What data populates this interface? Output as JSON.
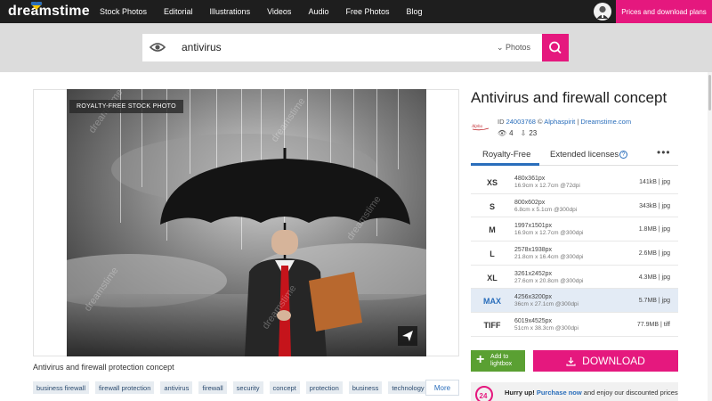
{
  "header": {
    "logo": "dreamstime",
    "nav": [
      "Stock Photos",
      "Editorial",
      "Illustrations",
      "Videos",
      "Audio",
      "Free Photos",
      "Blog"
    ],
    "plans_button": "Prices and download plans",
    "brand_color": "#e5187e"
  },
  "search": {
    "query": "antivirus",
    "category": "Photos"
  },
  "image": {
    "badge": "ROYALTY-FREE STOCK PHOTO",
    "caption": "Antivirus and firewall protection concept",
    "watermark": "dreamstime"
  },
  "tags": [
    "business firewall",
    "firewall protection",
    "antivirus",
    "firewall",
    "security",
    "concept",
    "protection",
    "business",
    "technology"
  ],
  "tags_more": "More",
  "detail": {
    "title": "Antivirus and firewall concept",
    "id_prefix": "ID ",
    "id": "24003768",
    "copyright": " © ",
    "author": "Alphaspirit",
    "separator": " | ",
    "site": "Dreamstime.com",
    "views": "4",
    "downloads": "23"
  },
  "license_tabs": {
    "royalty_free": "Royalty-Free",
    "extended": "Extended licenses",
    "help": "?",
    "more": "•••"
  },
  "sizes": [
    {
      "code": "XS",
      "px": "480x361px",
      "cm": "16.9cm x 12.7cm @72dpi",
      "size": "141kB | jpg"
    },
    {
      "code": "S",
      "px": "800x602px",
      "cm": "6.8cm x 5.1cm @300dpi",
      "size": "343kB | jpg"
    },
    {
      "code": "M",
      "px": "1997x1501px",
      "cm": "16.9cm x 12.7cm @300dpi",
      "size": "1.8MB | jpg"
    },
    {
      "code": "L",
      "px": "2578x1938px",
      "cm": "21.8cm x 16.4cm @300dpi",
      "size": "2.6MB | jpg"
    },
    {
      "code": "XL",
      "px": "3261x2452px",
      "cm": "27.6cm x 20.8cm @300dpi",
      "size": "4.3MB | jpg"
    },
    {
      "code": "MAX",
      "px": "4256x3200px",
      "cm": "36cm x 27.1cm @300dpi",
      "size": "5.7MB | jpg",
      "selected": true
    },
    {
      "code": "TIFF",
      "px": "6019x4525px",
      "cm": "51cm x 38.3cm @300dpi",
      "size": "77.9MB | tiff"
    }
  ],
  "actions": {
    "lightbox": "Add to lightbox",
    "download": "DOWNLOAD"
  },
  "promo": {
    "hurry": "Hurry up!",
    "purchase": "Purchase now",
    "rest": " and enjoy our discounted prices",
    "badge": "24"
  }
}
